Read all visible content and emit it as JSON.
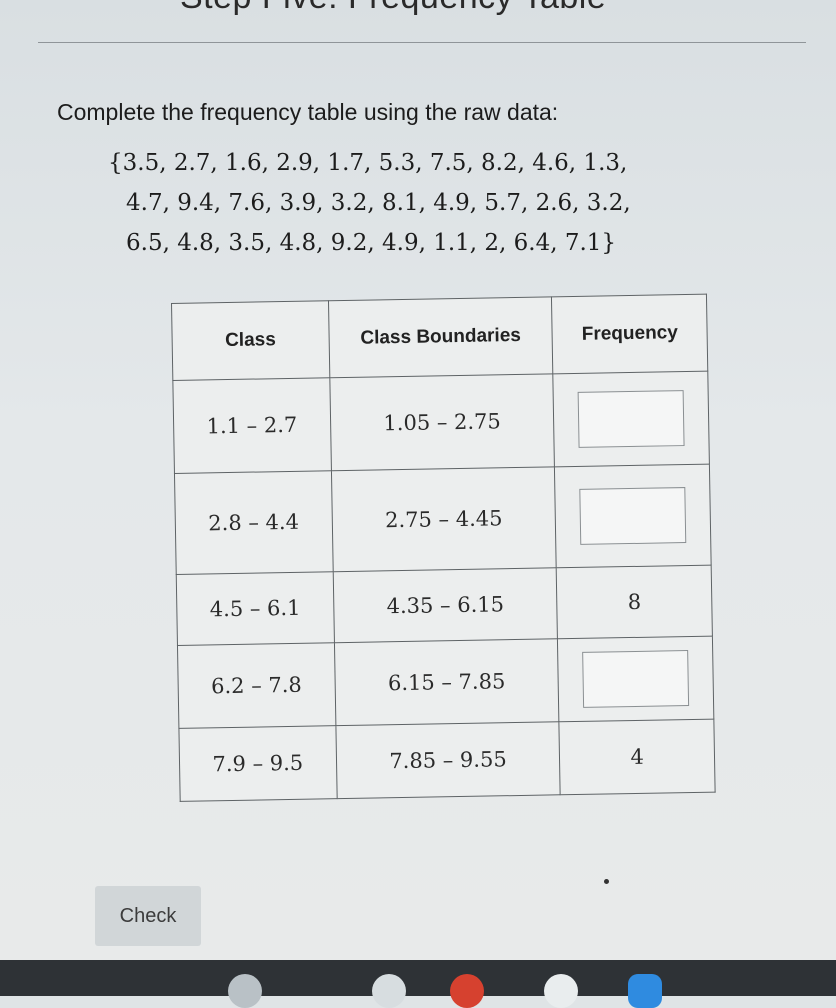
{
  "header": {
    "title": "Step Five: Frequency Table"
  },
  "question": {
    "instruction": "Complete the frequency table using the raw data:",
    "data_lines": [
      "{3.5, 2.7, 1.6, 2.9, 1.7, 5.3, 7.5, 8.2, 4.6, 1.3,",
      "4.7, 9.4, 7.6, 3.9, 3.2, 8.1, 4.9, 5.7, 2.6, 3.2,",
      "6.5, 4.8, 3.5, 4.8, 9.2, 4.9, 1.1, 2, 6.4, 7.1}"
    ]
  },
  "table": {
    "headers": [
      "Class",
      "Class Boundaries",
      "Frequency"
    ],
    "rows": [
      {
        "class": "1.1 – 2.7",
        "boundaries": "1.05 – 2.75",
        "frequency": ""
      },
      {
        "class": "2.8 – 4.4",
        "boundaries": "2.75 – 4.45",
        "frequency": ""
      },
      {
        "class": "4.5 – 6.1",
        "boundaries": "4.35 – 6.15",
        "frequency": "8"
      },
      {
        "class": "6.2 – 7.8",
        "boundaries": "6.15 – 7.85",
        "frequency": ""
      },
      {
        "class": "7.9 – 9.5",
        "boundaries": "7.85 – 9.55",
        "frequency": "4"
      }
    ]
  },
  "actions": {
    "check_label": "Check"
  },
  "taskbar": {
    "icons": [
      "launcher-icon",
      "chrome-icon",
      "youtube-icon",
      "play-store-icon",
      "files-icon"
    ]
  }
}
